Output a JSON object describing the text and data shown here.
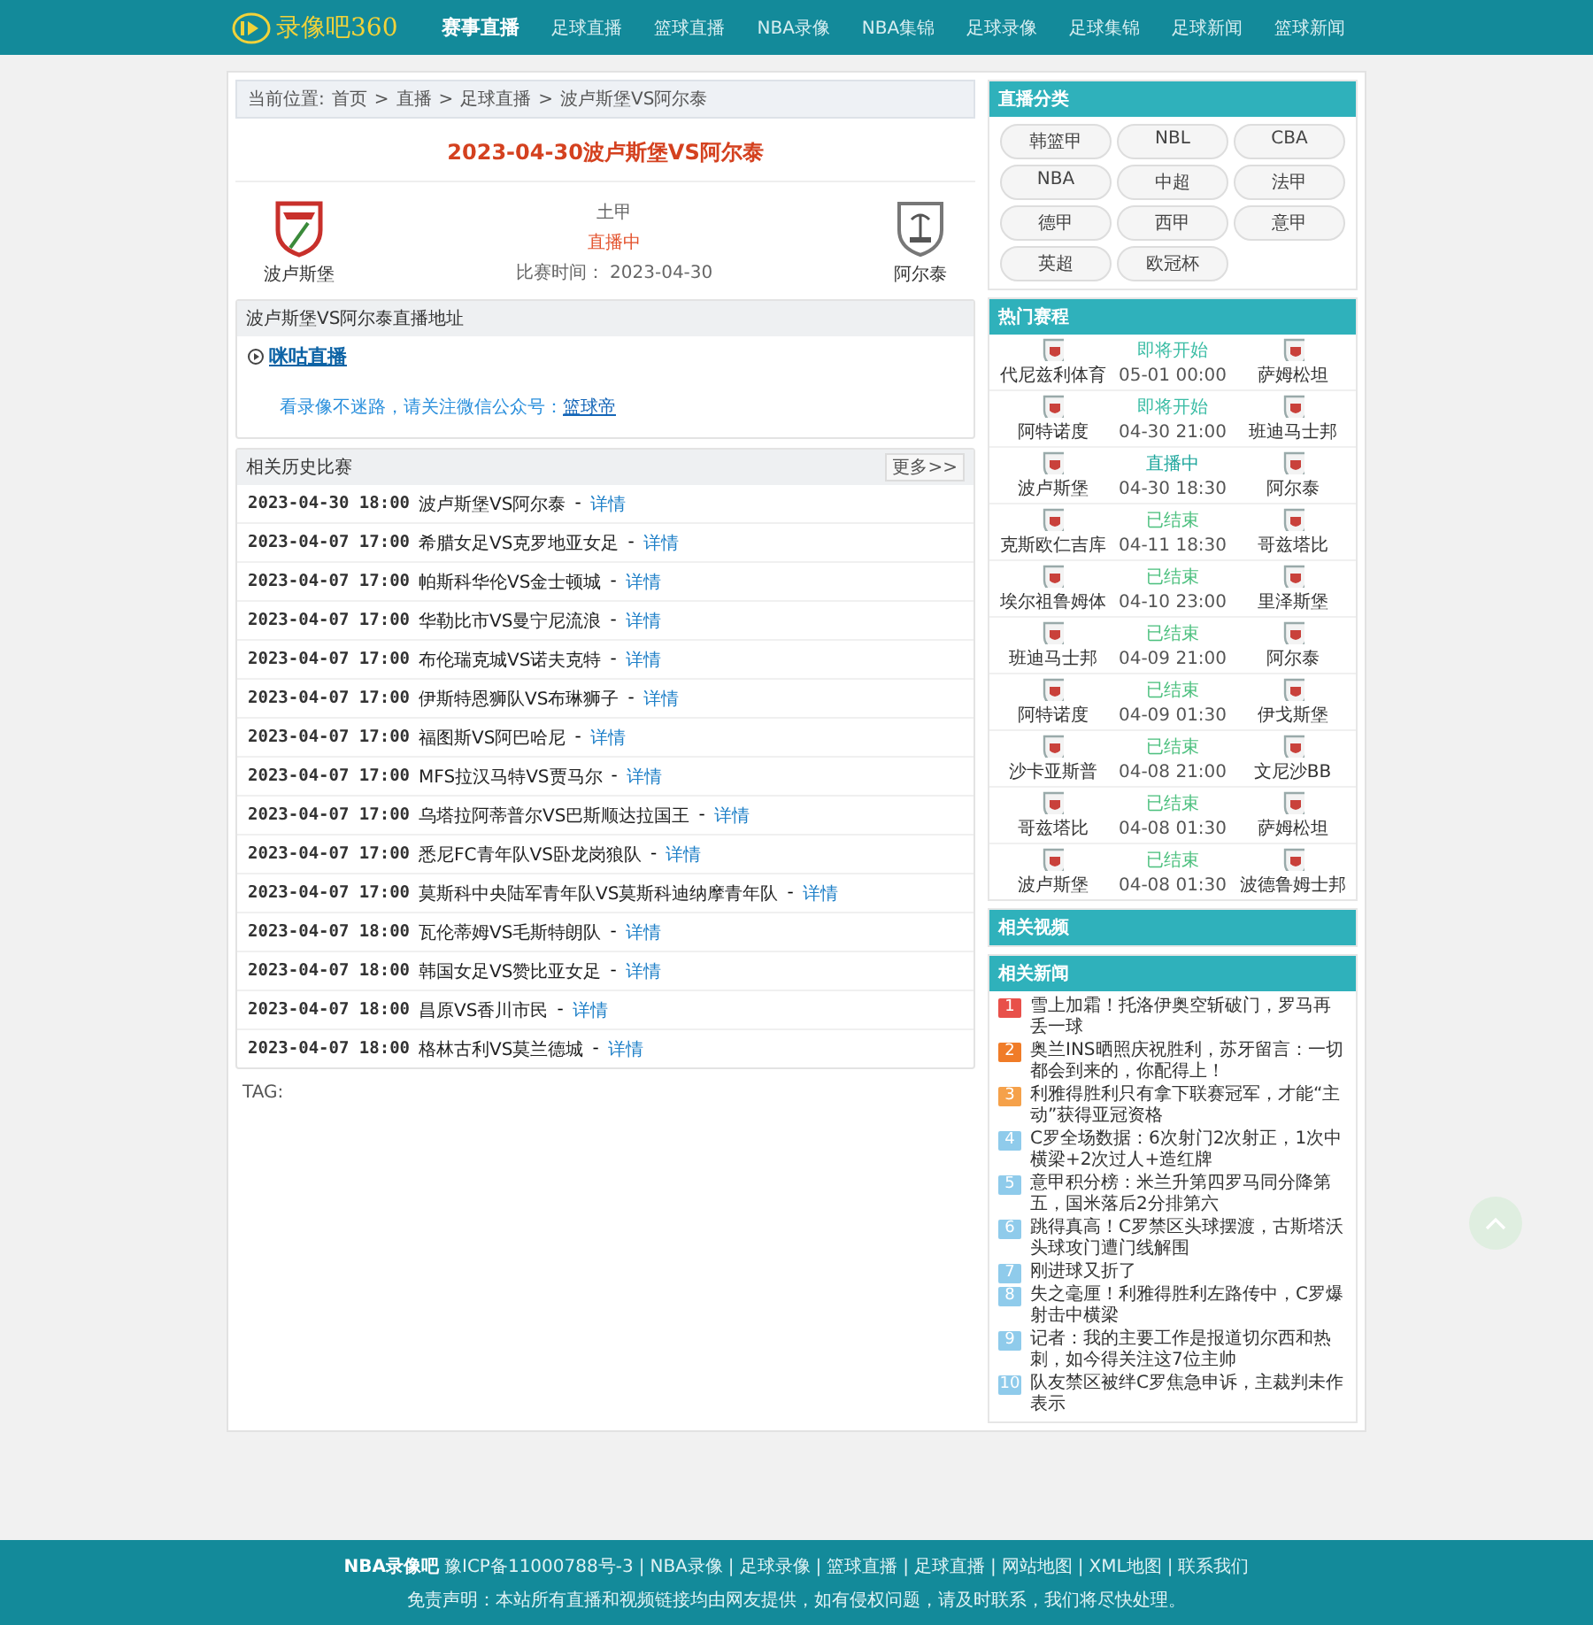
{
  "header": {
    "logo_text": "录像吧360",
    "nav": [
      {
        "label": "赛事直播",
        "selected": true
      },
      {
        "label": "足球直播",
        "selected": false
      },
      {
        "label": "篮球直播",
        "selected": false
      },
      {
        "label": "NBA录像",
        "selected": false
      },
      {
        "label": "NBA集锦",
        "selected": false
      },
      {
        "label": "足球录像",
        "selected": false
      },
      {
        "label": "足球集锦",
        "selected": false
      },
      {
        "label": "足球新闻",
        "selected": false
      },
      {
        "label": "篮球新闻",
        "selected": false
      }
    ]
  },
  "breadcrumb": {
    "label": "当前位置:",
    "items": [
      {
        "label": "首页",
        "separator": ">"
      },
      {
        "label": "直播",
        "separator": ">"
      },
      {
        "label": "足球直播",
        "separator": ">"
      },
      {
        "label": "波卢斯堡VS阿尔泰"
      }
    ]
  },
  "match": {
    "title": "2023-04-30波卢斯堡VS阿尔泰",
    "home": "波卢斯堡",
    "away": "阿尔泰",
    "league": "土甲",
    "status": "直播中",
    "time_label": "比赛时间：",
    "time": "2023-04-30"
  },
  "live_links": {
    "title": "波卢斯堡VS阿尔泰直播地址",
    "links": [
      "咪咕直播"
    ],
    "notice": "看录像不迷路，请关注微信公众号：",
    "account": "篮球帝"
  },
  "history": {
    "title": "相关历史比赛",
    "more": "更多>>",
    "rows": [
      {
        "time": "2023-04-30 18:00",
        "match": "波卢斯堡VS阿尔泰",
        "separator": "-",
        "link": "详情"
      },
      {
        "time": "2023-04-07 17:00",
        "match": "希腊女足VS克罗地亚女足",
        "separator": "-",
        "link": "详情"
      },
      {
        "time": "2023-04-07 17:00",
        "match": "帕斯科华伦VS金士顿城",
        "separator": "-",
        "link": "详情"
      },
      {
        "time": "2023-04-07 17:00",
        "match": "华勒比市VS曼宁尼流浪",
        "separator": "-",
        "link": "详情"
      },
      {
        "time": "2023-04-07 17:00",
        "match": "布伦瑞克城VS诺夫克特",
        "separator": "-",
        "link": "详情"
      },
      {
        "time": "2023-04-07 17:00",
        "match": "伊斯特恩狮队VS布琳狮子",
        "separator": "-",
        "link": "详情"
      },
      {
        "time": "2023-04-07 17:00",
        "match": "福图斯VS阿巴哈尼",
        "separator": "-",
        "link": "详情"
      },
      {
        "time": "2023-04-07 17:00",
        "match": "MFS拉汉马特VS贾马尔",
        "separator": "-",
        "link": "详情"
      },
      {
        "time": "2023-04-07 17:00",
        "match": "乌塔拉阿蒂普尔VS巴斯顺达拉国王",
        "separator": "-",
        "link": "详情"
      },
      {
        "time": "2023-04-07 17:00",
        "match": "悉尼FC青年队VS卧龙岗狼队",
        "separator": "-",
        "link": "详情"
      },
      {
        "time": "2023-04-07 17:00",
        "match": "莫斯科中央陆军青年队VS莫斯科迪纳摩青年队",
        "separator": "-",
        "link": "详情"
      },
      {
        "time": "2023-04-07 18:00",
        "match": "瓦伦蒂姆VS毛斯特朗队",
        "separator": "-",
        "link": "详情"
      },
      {
        "time": "2023-04-07 18:00",
        "match": "韩国女足VS赞比亚女足",
        "separator": "-",
        "link": "详情"
      },
      {
        "time": "2023-04-07 18:00",
        "match": "昌原VS香川市民",
        "separator": "-",
        "link": "详情"
      },
      {
        "time": "2023-04-07 18:00",
        "match": "格林古利VS莫兰德城",
        "separator": "-",
        "link": "详情"
      }
    ]
  },
  "tag_label": "TAG:",
  "sidebar": {
    "categories": {
      "title": "直播分类",
      "items": [
        "韩篮甲",
        "NBL",
        "CBA",
        "NBA",
        "中超",
        "法甲",
        "德甲",
        "西甲",
        "意甲",
        "英超",
        "欧冠杯"
      ]
    },
    "hot": {
      "title": "热门赛程",
      "matches": [
        {
          "home": "代尼兹利体育",
          "away": "萨姆松坦",
          "status": "即将开始",
          "kind": "upcoming",
          "time": "05-01 00:00"
        },
        {
          "home": "阿特诺度",
          "away": "班迪马士邦",
          "status": "即将开始",
          "kind": "upcoming",
          "time": "04-30 21:00"
        },
        {
          "home": "波卢斯堡",
          "away": "阿尔泰",
          "status": "直播中",
          "kind": "live",
          "time": "04-30 18:30"
        },
        {
          "home": "克斯欧仁吉库",
          "away": "哥兹塔比",
          "status": "已结束",
          "kind": "finished",
          "time": "04-11 18:30"
        },
        {
          "home": "埃尔祖鲁姆体",
          "away": "里泽斯堡",
          "status": "已结束",
          "kind": "finished",
          "time": "04-10 23:00"
        },
        {
          "home": "班迪马士邦",
          "away": "阿尔泰",
          "status": "已结束",
          "kind": "finished",
          "time": "04-09 21:00"
        },
        {
          "home": "阿特诺度",
          "away": "伊戈斯堡",
          "status": "已结束",
          "kind": "finished",
          "time": "04-09 01:30"
        },
        {
          "home": "沙卡亚斯普",
          "away": "文尼沙BB",
          "status": "已结束",
          "kind": "finished",
          "time": "04-08 21:00"
        },
        {
          "home": "哥兹塔比",
          "away": "萨姆松坦",
          "status": "已结束",
          "kind": "finished",
          "time": "04-08 01:30"
        },
        {
          "home": "波卢斯堡",
          "away": "波德鲁姆士邦",
          "status": "已结束",
          "kind": "finished",
          "time": "04-08 01:30"
        }
      ]
    },
    "videos": {
      "title": "相关视频"
    },
    "news": {
      "title": "相关新闻",
      "items": [
        {
          "rank": "1",
          "color": "#e8504a",
          "text": "雪上加霜！托洛伊奥空斩破门，罗马再丢一球"
        },
        {
          "rank": "2",
          "color": "#f07c28",
          "text": "奥兰INS晒照庆祝胜利，苏牙留言：一切都会到来的，你配得上！"
        },
        {
          "rank": "3",
          "color": "#f5a14a",
          "text": "利雅得胜利只有拿下联赛冠军，才能“主动”获得亚冠资格"
        },
        {
          "rank": "4",
          "color": "#8fcbeb",
          "text": "C罗全场数据：6次射门2次射正，1次中横梁+2次过人+造红牌"
        },
        {
          "rank": "5",
          "color": "#8fcbeb",
          "text": "意甲积分榜：米兰升第四罗马同分降第五，国米落后2分排第六"
        },
        {
          "rank": "6",
          "color": "#8fcbeb",
          "text": "跳得真高！C罗禁区头球摆渡，古斯塔沃头球攻门遭门线解围"
        },
        {
          "rank": "7",
          "color": "#8fcbeb",
          "text": "刚进球又折了"
        },
        {
          "rank": "8",
          "color": "#8fcbeb",
          "text": "失之毫厘！利雅得胜利左路传中，C罗爆射击中横梁"
        },
        {
          "rank": "9",
          "color": "#8fcbeb",
          "text": "记者：我的主要工作是报道切尔西和热刺，如今得关注这7位主帅"
        },
        {
          "rank": "10",
          "color": "#8fcbeb",
          "text": "队友禁区被绊C罗焦急申诉，主裁判未作表示"
        }
      ]
    }
  },
  "footer": {
    "site": "NBA录像吧",
    "icp": "豫ICP备11000788号-3",
    "links": [
      "NBA录像",
      "足球录像",
      "篮球直播",
      "足球直播",
      "网站地图",
      "XML地图",
      "联系我们"
    ],
    "separator": "|",
    "disclaimer": "免责声明：本站所有直播和视频链接均由网友提供，如有侵权问题，请及时联系，我们将尽快处理。"
  }
}
